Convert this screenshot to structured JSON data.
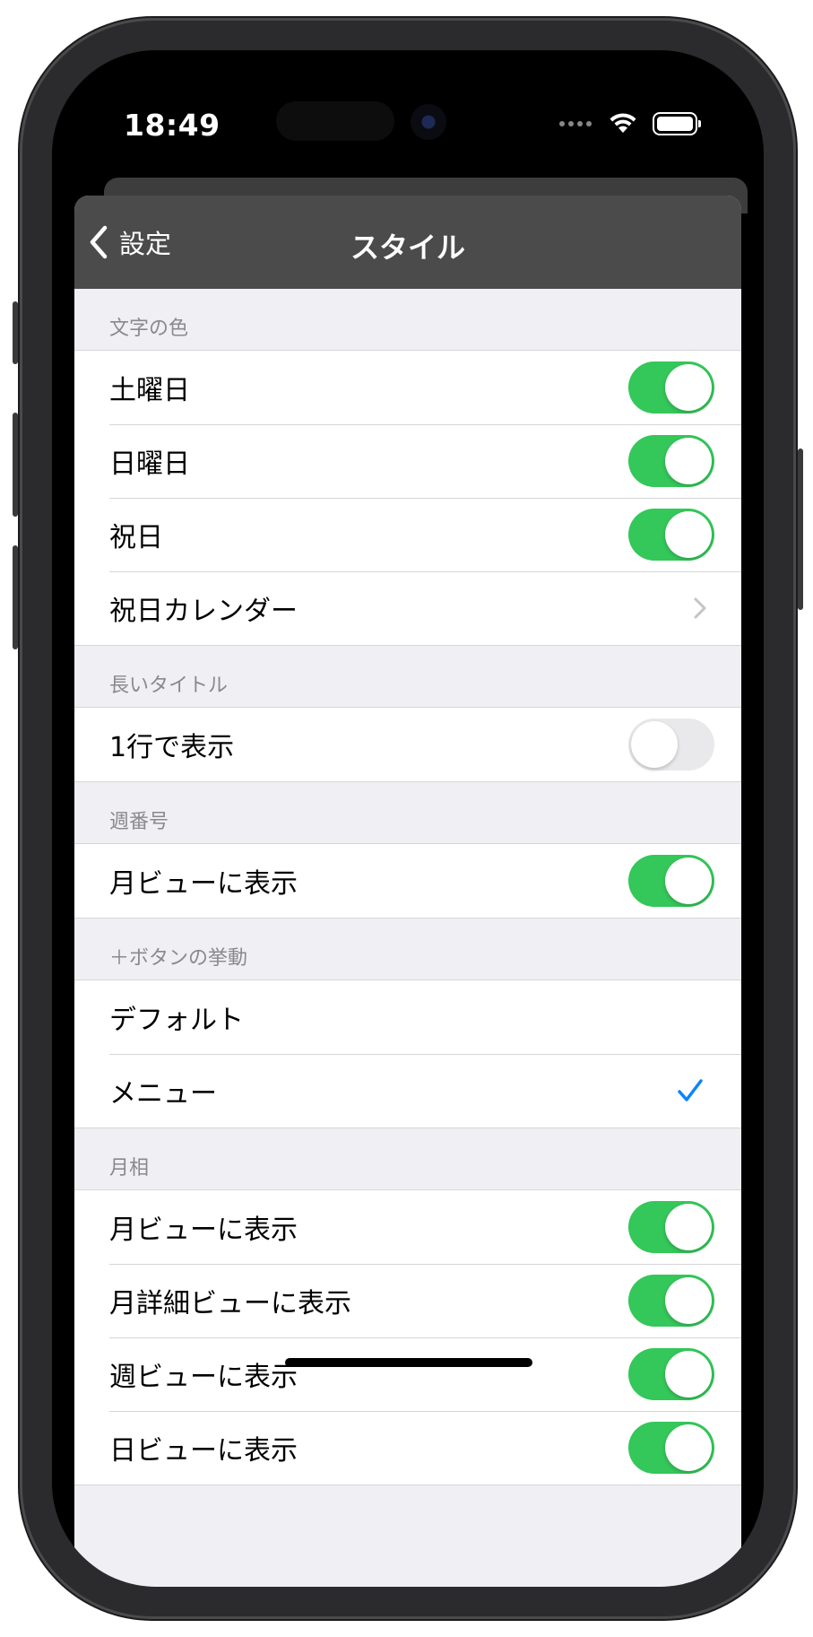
{
  "status_bar": {
    "time": "18:49"
  },
  "nav": {
    "back_label": "設定",
    "title": "スタイル"
  },
  "sections": {
    "text_color": {
      "header": "文字の色",
      "saturday": {
        "label": "土曜日",
        "on": true
      },
      "sunday": {
        "label": "日曜日",
        "on": true
      },
      "holiday": {
        "label": "祝日",
        "on": true
      },
      "holiday_calendar": {
        "label": "祝日カレンダー"
      }
    },
    "long_title": {
      "header": "長いタイトル",
      "one_line": {
        "label": "1行で表示",
        "on": false
      }
    },
    "week_number": {
      "header": "週番号",
      "month_view": {
        "label": "月ビューに表示",
        "on": true
      }
    },
    "plus_button": {
      "header": "＋ボタンの挙動",
      "default": {
        "label": "デフォルト"
      },
      "menu": {
        "label": "メニュー",
        "selected": true
      }
    },
    "moon_phase": {
      "header": "月相",
      "month_view": {
        "label": "月ビューに表示",
        "on": true
      },
      "month_detail_view": {
        "label": "月詳細ビューに表示",
        "on": true
      },
      "week_view": {
        "label": "週ビューに表示",
        "on": true
      },
      "day_view": {
        "label": "日ビューに表示",
        "on": true
      }
    }
  },
  "colors": {
    "toggle_on": "#34c759",
    "toggle_off": "#e9e9eb",
    "accent": "#0a84ff",
    "navbar": "#4b4b4b"
  }
}
